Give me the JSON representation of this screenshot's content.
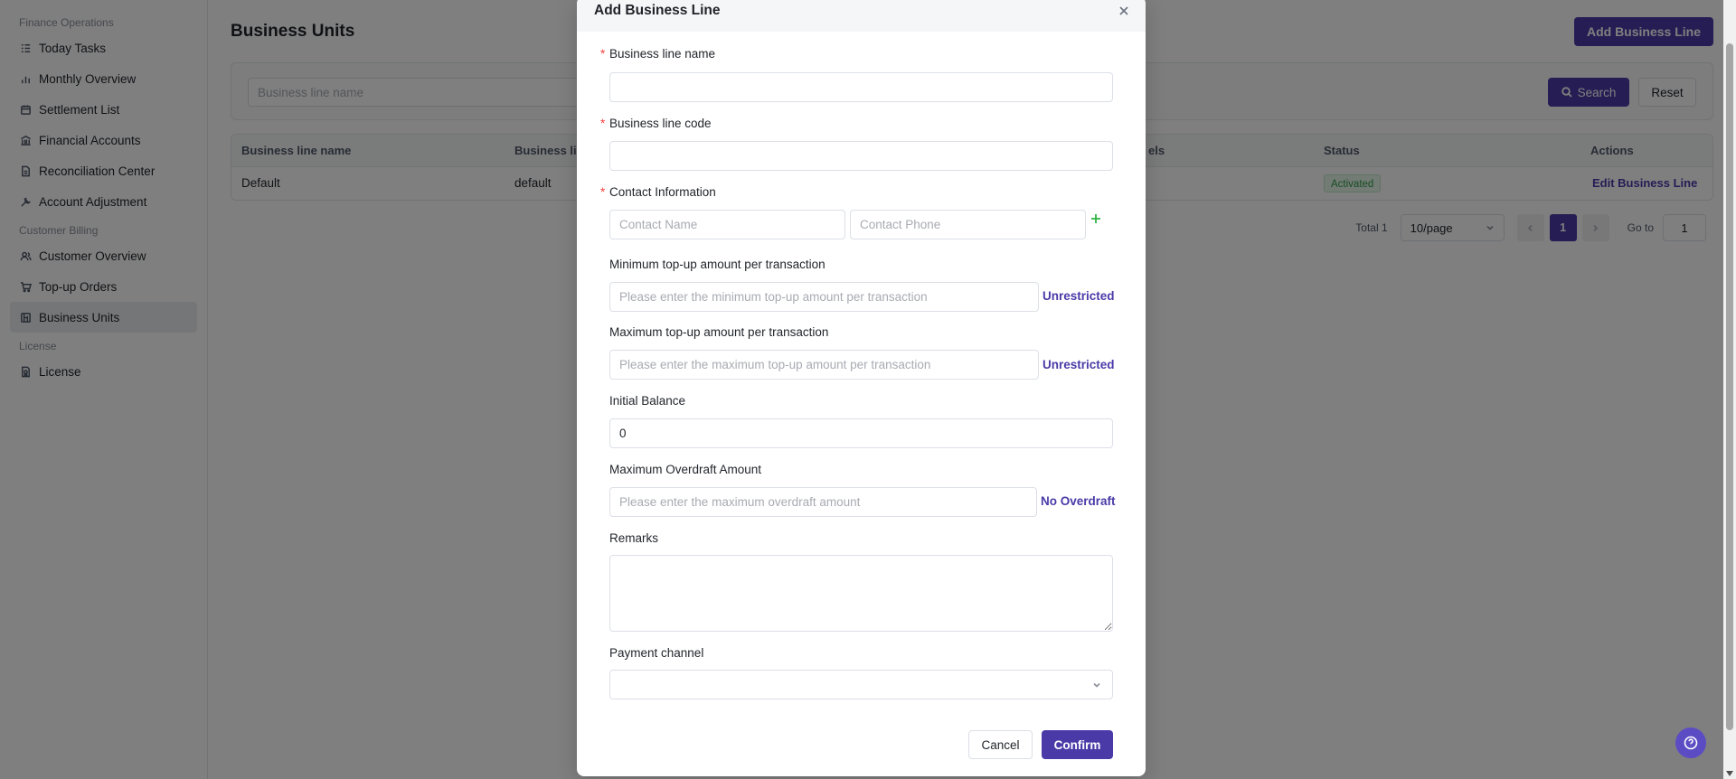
{
  "sidebar": {
    "groups": [
      {
        "title": "Finance Operations",
        "items": [
          {
            "label": "Today Tasks",
            "icon": "list-icon"
          },
          {
            "label": "Monthly Overview",
            "icon": "bar-chart-icon"
          },
          {
            "label": "Settlement List",
            "icon": "calendar-icon"
          },
          {
            "label": "Financial Accounts",
            "icon": "bank-icon"
          },
          {
            "label": "Reconciliation Center",
            "icon": "document-icon"
          },
          {
            "label": "Account Adjustment",
            "icon": "wrench-icon"
          }
        ]
      },
      {
        "title": "Customer Billing",
        "items": [
          {
            "label": "Customer Overview",
            "icon": "users-icon"
          },
          {
            "label": "Top-up Orders",
            "icon": "cart-icon"
          },
          {
            "label": "Business Units",
            "icon": "building-icon",
            "active": true
          }
        ]
      },
      {
        "title": "License",
        "items": [
          {
            "label": "License",
            "icon": "license-icon"
          }
        ]
      }
    ]
  },
  "page": {
    "title": "Business Units",
    "add_button": "Add Business Line",
    "filter": {
      "name_placeholder": "Business line name",
      "search_label": "Search",
      "reset_label": "Reset"
    },
    "table": {
      "headers": [
        "Business line name",
        "Business lin",
        "els",
        "Status",
        "Actions"
      ],
      "rows": [
        {
          "name": "Default",
          "code": "default",
          "status": "Activated",
          "action": "Edit Business Line"
        }
      ]
    },
    "pagination": {
      "total": "Total 1",
      "page_size": "10/page",
      "current_page": "1",
      "goto_label": "Go to",
      "goto_value": "1"
    }
  },
  "modal": {
    "title": "Add Business Line",
    "fields": {
      "name_label": "Business line name",
      "code_label": "Business line code",
      "contact_label": "Contact Information",
      "contact_name_placeholder": "Contact Name",
      "contact_phone_placeholder": "Contact Phone",
      "min_label": "Minimum top-up amount per transaction",
      "min_placeholder": "Please enter the minimum top-up amount per transaction",
      "min_link": "Unrestricted",
      "max_label": "Maximum top-up amount per transaction",
      "max_placeholder": "Please enter the maximum top-up amount per transaction",
      "max_link": "Unrestricted",
      "balance_label": "Initial Balance",
      "balance_value": "0",
      "overdraft_label": "Maximum Overdraft Amount",
      "overdraft_placeholder": "Please enter the maximum overdraft amount",
      "overdraft_link": "No Overdraft",
      "remarks_label": "Remarks",
      "channel_label": "Payment channel"
    },
    "required_mark": "*",
    "cancel_label": "Cancel",
    "confirm_label": "Confirm"
  },
  "colors": {
    "primary": "#4a3aa8",
    "required": "#f53f3f",
    "success": "#2e9d49"
  }
}
